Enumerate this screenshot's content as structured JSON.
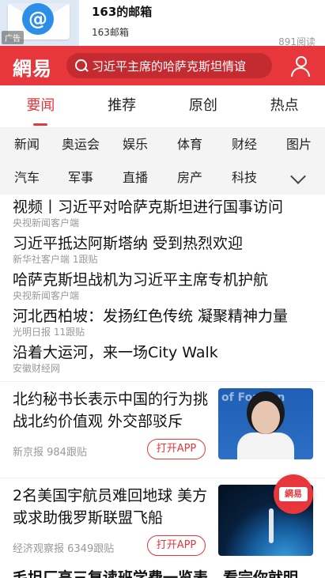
{
  "ad": {
    "icon": "mail-at-icon",
    "tag": "广告",
    "title": "163的邮箱",
    "subtitle": "163邮箱",
    "reads": "891阅读"
  },
  "header": {
    "logo": "網易",
    "search_text": "习近平主席的哈萨克斯坦情谊"
  },
  "tabs": [
    {
      "label": "要闻",
      "active": true
    },
    {
      "label": "推荐"
    },
    {
      "label": "原创"
    },
    {
      "label": "热点"
    }
  ],
  "channels": {
    "row1": [
      "新闻",
      "奥运会",
      "娱乐",
      "体育",
      "财经",
      "图片"
    ],
    "row2": [
      "汽车",
      "军事",
      "直播",
      "房产",
      "科技"
    ]
  },
  "news": [
    {
      "title": "视频丨习近平对哈萨克斯坦进行国事访问",
      "meta": "央视新闻客户端"
    },
    {
      "title": "习近平抵达阿斯塔纳 受到热烈欢迎",
      "meta": "新华社客户端 1跟贴"
    },
    {
      "title": "哈萨克斯坦战机为习近平主席专机护航",
      "meta": "央视新闻客户端"
    },
    {
      "title": "河北西柏坡：发扬红色传统 凝聚精神力量",
      "meta": "光明日报 11跟贴"
    },
    {
      "title": "沿着大运河，来一场City Walk",
      "meta": "安徽财经网"
    }
  ],
  "cards": [
    {
      "title": "北约秘书长表示中国的行为挑战北约价值观 外交部驳斥",
      "meta": "新京报  984跟贴",
      "button": "打开APP",
      "thumb_text": "of Foreign"
    },
    {
      "title": "2名美国宇航员难回地球 美方或求助俄罗斯联盟飞船",
      "meta": "经济观察报  6349跟贴",
      "button": "打开APP"
    }
  ],
  "float_logo": "網易",
  "cut_title": "毛坦厂高三复读班学费一览表，看完你就明"
}
